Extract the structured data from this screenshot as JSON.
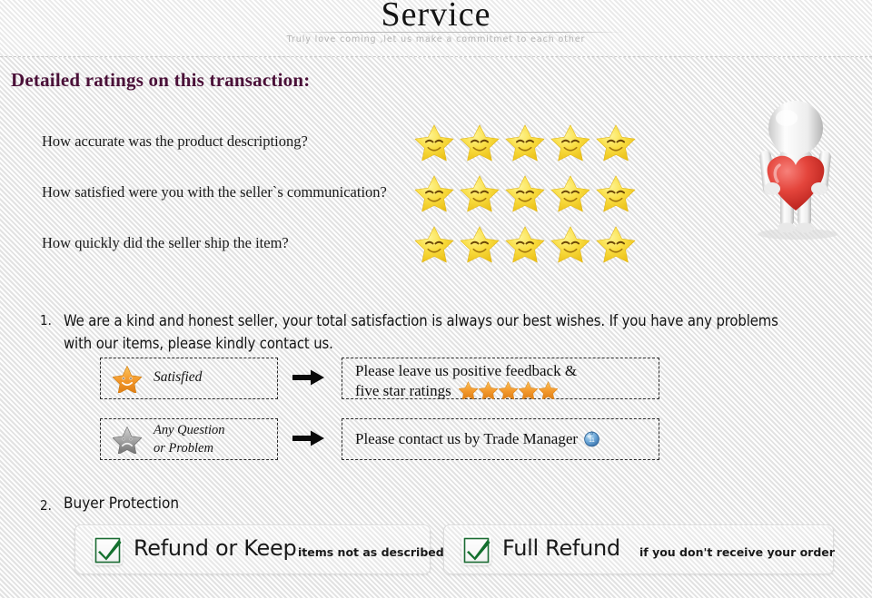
{
  "header": {
    "title": "Service",
    "tagline": "Truly love coming ,let us make a commitmet to each other"
  },
  "section": {
    "heading": "Detailed ratings on this transaction:"
  },
  "ratings": [
    {
      "question": "How accurate was the product descriptiong?",
      "stars": 5,
      "star_icon": "smiley-star-icon"
    },
    {
      "question": "How satisfied were you with the seller`s communication?",
      "stars": 5,
      "star_icon": "smiley-star-icon"
    },
    {
      "question": "How quickly did the seller ship the item?",
      "stars": 5,
      "star_icon": "smiley-star-icon"
    }
  ],
  "hero": {
    "icon": "3d-figure-holding-heart-icon",
    "heart_color": "#e03a33",
    "figure_color": "#f2f2f2"
  },
  "items": [
    {
      "number": "1.",
      "text": "We are a kind and honest seller, your total satisfaction is always our best wishes. If you have any problems with our items, please kindly contact us."
    },
    {
      "number": "2.",
      "text": "Buyer Protection"
    }
  ],
  "flows": [
    {
      "left_icon": "happy-star-icon",
      "left_label": "Satisfied",
      "arrow_icon": "right-arrow-icon",
      "right_line1": "Please leave us positive feedback &",
      "right_line2": "five star ratings",
      "right_stars": 5,
      "right_star_icon": "orange-star-icon"
    },
    {
      "left_icon": "sad-star-icon",
      "left_label_line1": "Any Question",
      "left_label_line2": "or Problem",
      "arrow_icon": "right-arrow-icon",
      "right_line1": "Please contact us by Trade Manager",
      "right_trailing_icon": "trade-manager-icon"
    }
  ],
  "protection": [
    {
      "check_icon": "green-check-icon",
      "title": "Refund or Keep",
      "subtitle": "items not as described"
    },
    {
      "check_icon": "green-check-icon",
      "title": "Full Refund",
      "subtitle": "if you don't receive your order"
    }
  ],
  "colors": {
    "heading": "#4a1038",
    "star_yellow": "#f6d32e",
    "star_orange": "#f0982c",
    "check_green": "#12762f",
    "heart_red": "#e03a33"
  }
}
